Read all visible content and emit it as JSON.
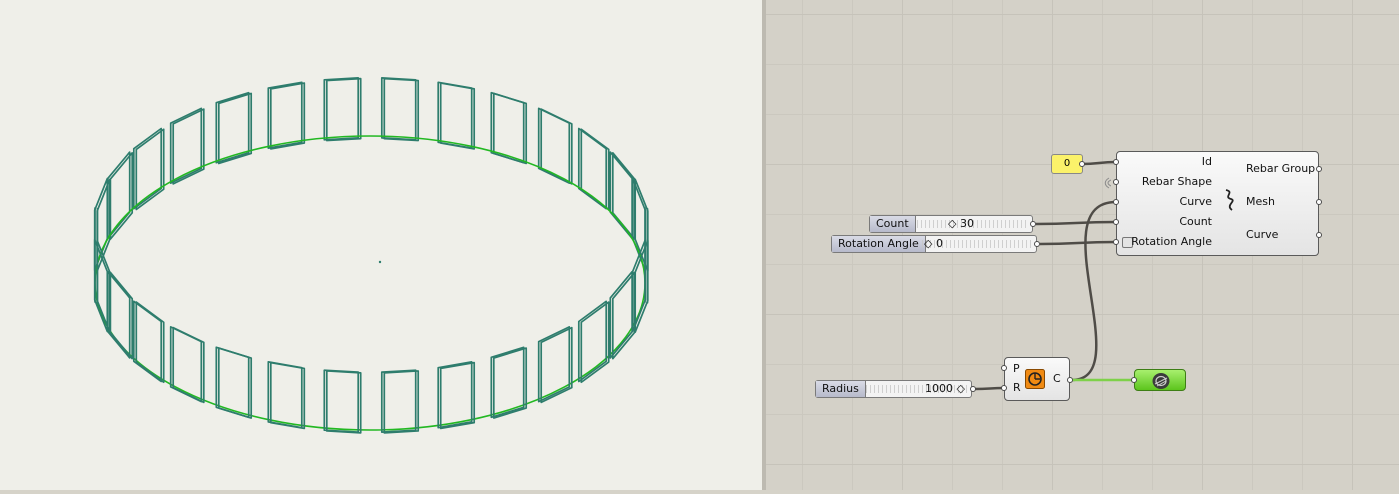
{
  "viewport": {
    "colors": {
      "rebar": "#2e7d6d",
      "circle": "#22b822",
      "background": "#efefe9"
    },
    "rebar_count": 30
  },
  "canvas": {
    "panel_value": "0",
    "rebar_component": {
      "inputs": [
        "Id",
        "Rebar Shape",
        "Curve",
        "Count",
        "Rotation Angle"
      ],
      "outputs": [
        "Rebar Group",
        "Mesh",
        "Curve"
      ],
      "icon": "rebar-wave-icon"
    },
    "sliders": {
      "count": {
        "name": "Count",
        "value": "◇ 30"
      },
      "rotation": {
        "name": "Rotation Angle",
        "value": "◇ 0"
      },
      "radius": {
        "name": "Radius",
        "value": "1000 ◇"
      }
    },
    "circle_component": {
      "inputs": [
        "P",
        "R"
      ],
      "outputs": [
        "C"
      ],
      "icon": "circle-icon"
    },
    "preview_icon": "preview-mesh-icon",
    "colors": {
      "wire": "#4f4c47",
      "wire_selected": "#7fd14a",
      "panel": "#fbf26a",
      "circle_icon": "#f08a12"
    }
  }
}
